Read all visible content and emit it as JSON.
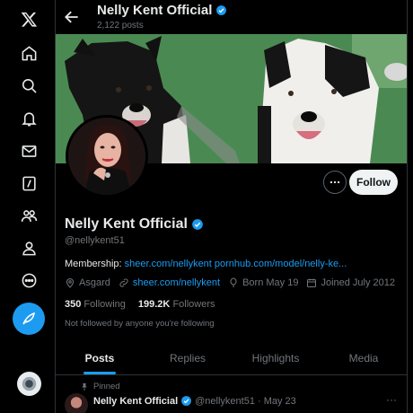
{
  "profile": {
    "name": "Nelly Kent Official",
    "posts_count": "2,122 posts",
    "handle": "@nellykent51",
    "bio_label": "Membership:",
    "bio_links": "sheer.com/nellykent pornhub.com/model/nelly-ke...",
    "location": "Asgard",
    "website": "sheer.com/nellykent",
    "born": "Born May 19",
    "joined": "Joined July 2012",
    "following_count": "350",
    "following_label": "Following",
    "followers_count": "199.2K",
    "followers_label": "Followers",
    "not_followed": "Not followed by anyone you're following",
    "follow_label": "Follow"
  },
  "tabs": [
    {
      "label": "Posts",
      "active": true
    },
    {
      "label": "Replies",
      "active": false
    },
    {
      "label": "Highlights",
      "active": false
    },
    {
      "label": "Media",
      "active": false
    }
  ],
  "pinned_post": {
    "pinned_label": "Pinned",
    "author": "Nelly Kent Official",
    "handle": "@nellykent51",
    "date": "· May 23",
    "more": "···"
  },
  "nav": {
    "icons": [
      "x-logo-icon",
      "home-icon",
      "search-icon",
      "notifications-icon",
      "messages-icon",
      "grok-icon",
      "communities-icon",
      "profile-icon",
      "more-icon",
      "compose-icon"
    ]
  },
  "colors": {
    "accent": "#1d9bf0",
    "background": "#000000",
    "muted_text": "#71767b"
  }
}
